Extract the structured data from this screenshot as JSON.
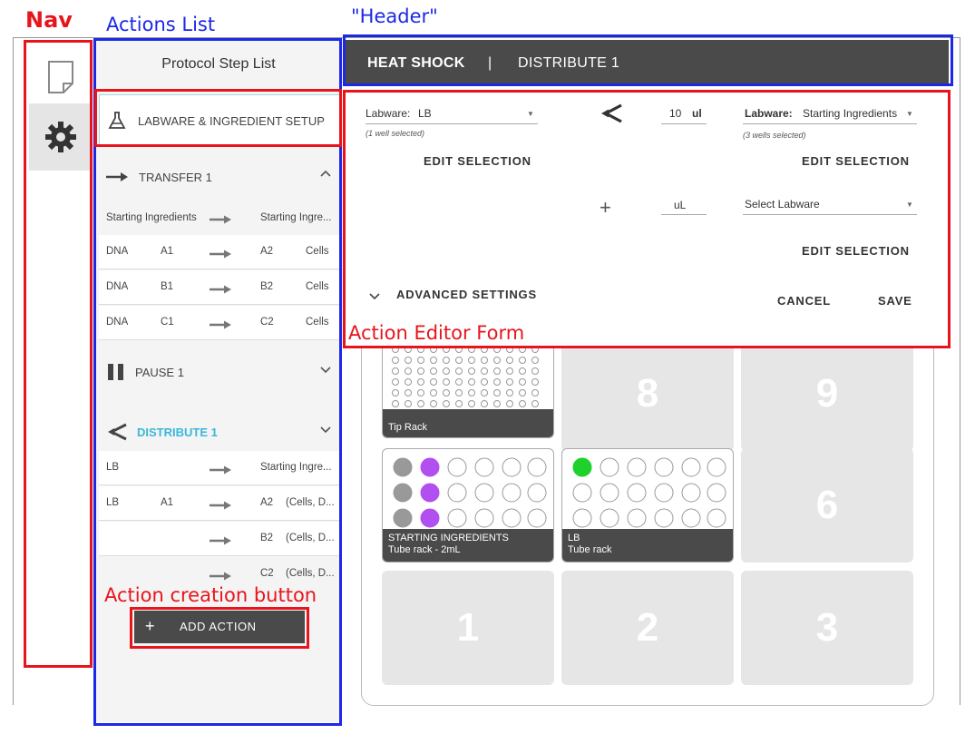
{
  "annotations": {
    "nav": "Nav",
    "actions_list": "Actions List",
    "header": "\"Header\"",
    "action_editor_form": "Action Editor Form",
    "action_creation_button": "Action creation button"
  },
  "nav": {
    "items": [
      {
        "icon": "file-icon"
      },
      {
        "icon": "gear-icon",
        "active": true
      }
    ]
  },
  "sidebar": {
    "title": "Protocol Step List",
    "labware_setup": "LABWARE & INGREDIENT SETUP",
    "transfer": {
      "title": "TRANSFER 1",
      "header": {
        "from": "Starting Ingredients",
        "to": "Starting Ingre..."
      },
      "rows": [
        {
          "ingredient": "DNA",
          "from": "A1",
          "to": "A2",
          "dest": "Cells"
        },
        {
          "ingredient": "DNA",
          "from": "B1",
          "to": "B2",
          "dest": "Cells"
        },
        {
          "ingredient": "DNA",
          "from": "C1",
          "to": "C2",
          "dest": "Cells"
        }
      ]
    },
    "pause": {
      "title": "PAUSE 1"
    },
    "distribute": {
      "title": "DISTRIBUTE 1",
      "header": {
        "from": "LB",
        "to": "Starting Ingre..."
      },
      "rows": [
        {
          "ingredient": "LB",
          "from": "A1",
          "to": "A2",
          "dest": "(Cells, D..."
        },
        {
          "ingredient": "",
          "from": "",
          "to": "B2",
          "dest": "(Cells, D..."
        },
        {
          "ingredient": "",
          "from": "",
          "to": "C2",
          "dest": "(Cells, D..."
        }
      ]
    },
    "add_action": "ADD ACTION"
  },
  "header": {
    "title": "HEAT SHOCK",
    "separator": "|",
    "subtitle": "DISTRIBUTE 1"
  },
  "form": {
    "source": {
      "label": "Labware:",
      "value": "LB",
      "selected": "(1 well selected)",
      "edit": "EDIT SELECTION"
    },
    "volume": {
      "value": "10",
      "unit": "ul"
    },
    "dest": {
      "label": "Labware:",
      "value": "Starting Ingredients",
      "selected": "(3 wells selected)",
      "edit": "EDIT SELECTION"
    },
    "extra": {
      "plus": "+",
      "unit": "uL",
      "select_placeholder": "Select Labware",
      "edit": "EDIT SELECTION"
    },
    "advanced": "ADVANCED SETTINGS",
    "cancel": "CANCEL",
    "save": "SAVE"
  },
  "deck": {
    "slots": [
      "1",
      "2",
      "3",
      "6",
      "8",
      "9"
    ],
    "labware": [
      {
        "name": "Tip Rack"
      },
      {
        "name": "STARTING INGREDIENTS",
        "type": "Tube rack - 2mL"
      },
      {
        "name": "LB",
        "type": "Tube rack"
      }
    ]
  },
  "colors": {
    "annotation_red": "#e8141c",
    "annotation_blue": "#1c28e6",
    "accent": "#3ab7d9",
    "dark_bar": "#4a4a4a",
    "well_gray": "#999999",
    "well_purple": "#b14ff0",
    "well_green": "#1ed12b"
  }
}
